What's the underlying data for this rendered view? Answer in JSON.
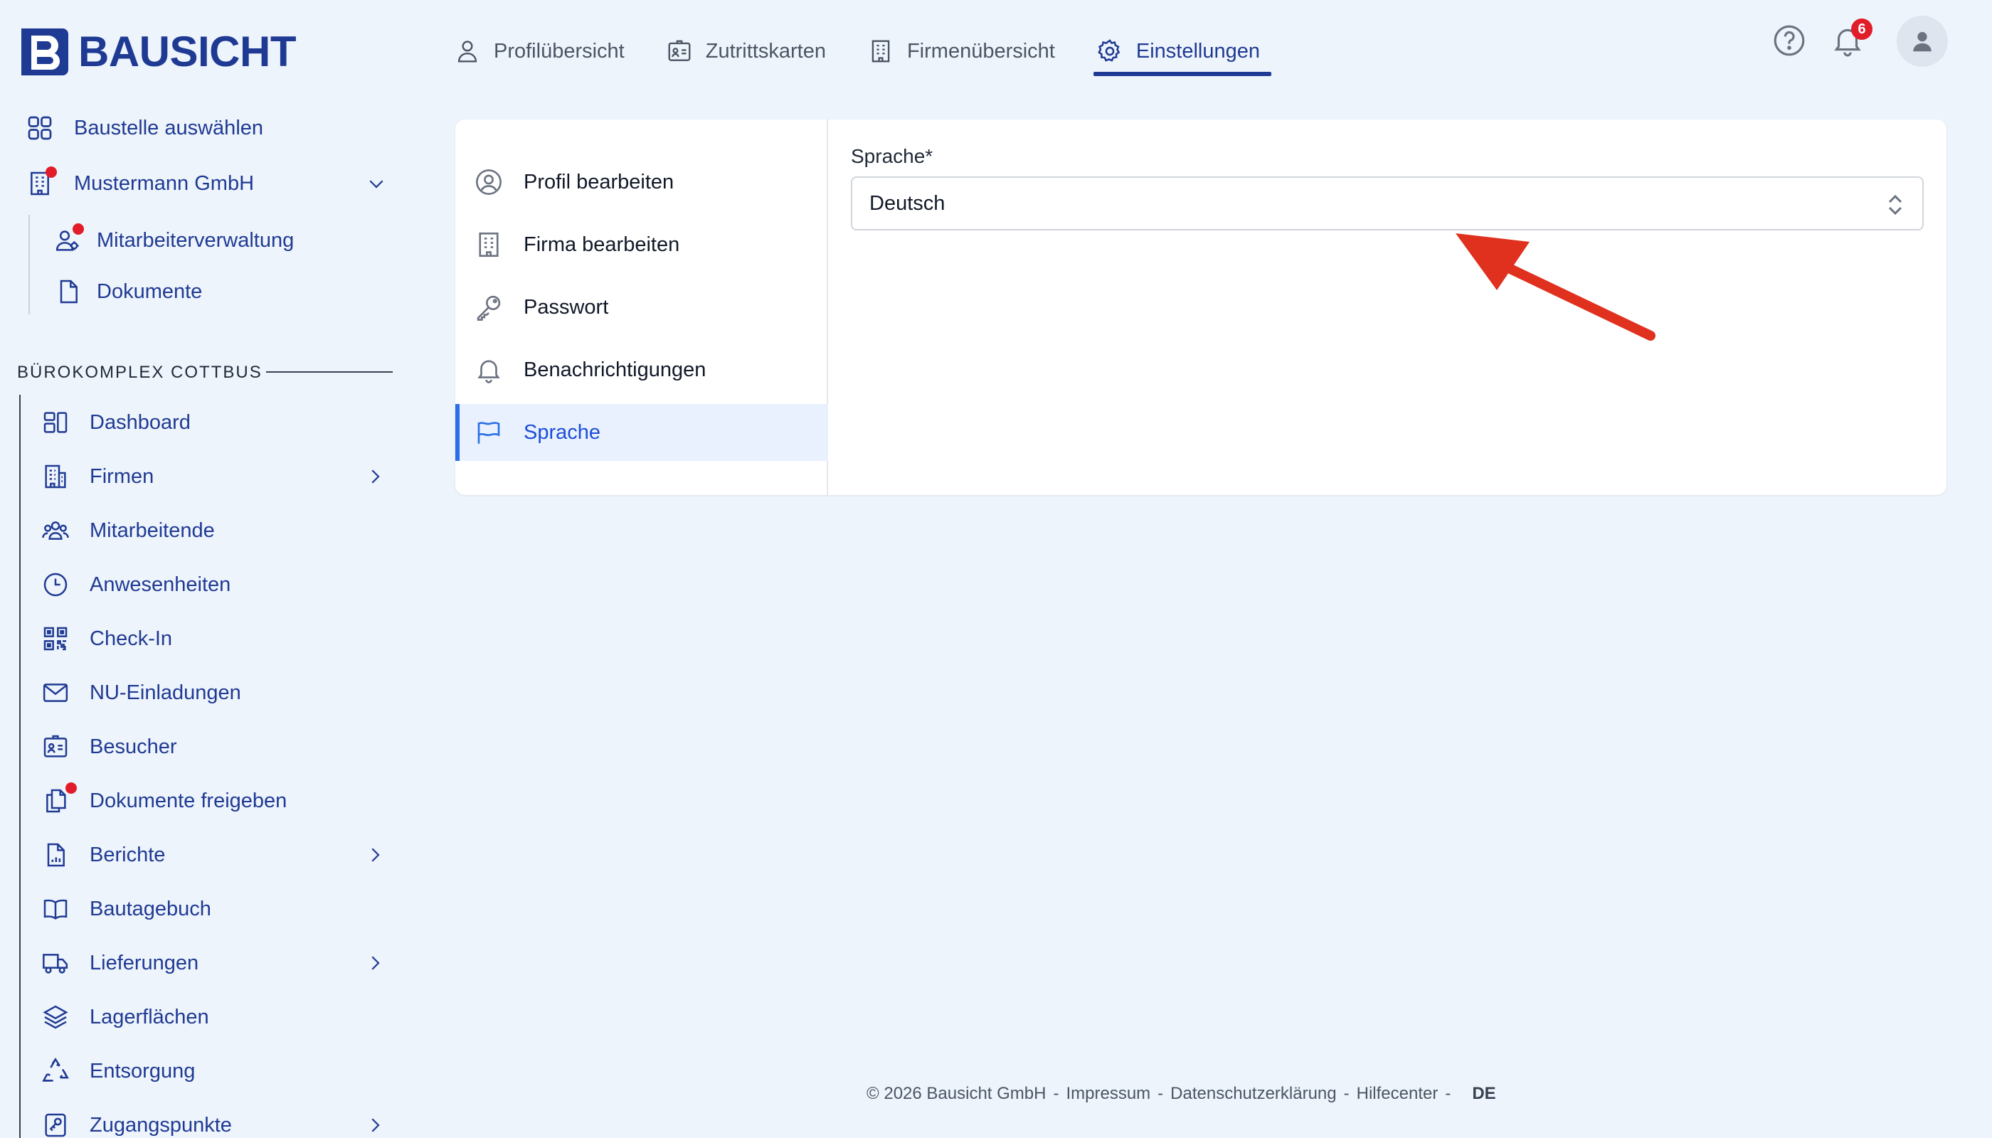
{
  "brand": {
    "name": "BAUSICHT",
    "color": "#1f3a93"
  },
  "topnav": {
    "tabs": [
      {
        "label": "Profilübersicht",
        "icon": "user-icon"
      },
      {
        "label": "Zutrittskarten",
        "icon": "id-card-icon"
      },
      {
        "label": "Firmenübersicht",
        "icon": "building-icon"
      },
      {
        "label": "Einstellungen",
        "icon": "gear-icon",
        "active": true
      }
    ],
    "notification_count": "6"
  },
  "sidebar": {
    "select_site": "Baustelle auswählen",
    "company": "Mustermann GmbH",
    "company_items": [
      "Mitarbeiterverwaltung",
      "Dokumente"
    ],
    "section_title": "BÜROKOMPLEX COTTBUS",
    "items": [
      {
        "label": "Dashboard",
        "icon": "dashboard-icon"
      },
      {
        "label": "Firmen",
        "icon": "building-icon",
        "has_children": true
      },
      {
        "label": "Mitarbeitende",
        "icon": "users-icon"
      },
      {
        "label": "Anwesenheiten",
        "icon": "clock-icon"
      },
      {
        "label": "Check-In",
        "icon": "qr-code-icon"
      },
      {
        "label": "NU-Einladungen",
        "icon": "envelope-icon"
      },
      {
        "label": "Besucher",
        "icon": "visitor-badge-icon"
      },
      {
        "label": "Dokumente freigeben",
        "icon": "documents-icon",
        "notification_dot": true
      },
      {
        "label": "Berichte",
        "icon": "report-icon",
        "has_children": true
      },
      {
        "label": "Bautagebuch",
        "icon": "book-icon"
      },
      {
        "label": "Lieferungen",
        "icon": "truck-icon",
        "has_children": true
      },
      {
        "label": "Lagerflächen",
        "icon": "layers-icon"
      },
      {
        "label": "Entsorgung",
        "icon": "recycle-icon"
      },
      {
        "label": "Zugangspunkte",
        "icon": "access-point-icon",
        "has_children": true
      }
    ]
  },
  "settings_menu": {
    "items": [
      {
        "label": "Profil bearbeiten",
        "icon": "user-circle-icon"
      },
      {
        "label": "Firma bearbeiten",
        "icon": "building-icon"
      },
      {
        "label": "Passwort",
        "icon": "key-icon"
      },
      {
        "label": "Benachrichtigungen",
        "icon": "bell-icon"
      },
      {
        "label": "Sprache",
        "icon": "flag-icon",
        "active": true
      }
    ]
  },
  "language_form": {
    "label": "Sprache*",
    "value": "Deutsch"
  },
  "footer": {
    "copyright": "© 2026 Bausicht GmbH",
    "links": [
      "Impressum",
      "Datenschutzerklärung",
      "Hilfecenter"
    ],
    "separator": "-",
    "language": "DE"
  },
  "colors": {
    "accent": "#1f3a93",
    "active_bg": "#e8f1fd",
    "badge": "#e11d2a",
    "annotation_arrow": "#e0301e"
  }
}
